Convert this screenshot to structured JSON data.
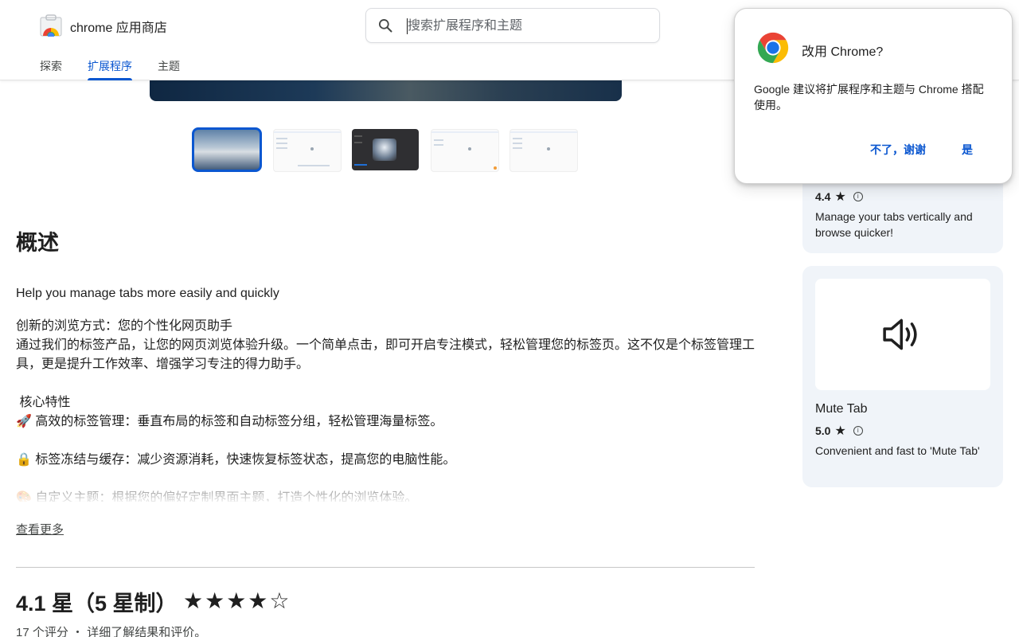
{
  "header": {
    "brand": "chrome 应用商店",
    "search_placeholder": "搜索扩展程序和主题",
    "tabs": [
      {
        "label": "探索",
        "active": false
      },
      {
        "label": "扩展程序",
        "active": true
      },
      {
        "label": "主题",
        "active": false
      }
    ],
    "accent_color": "#0b57d0"
  },
  "overview": {
    "title": "概述",
    "summary": "Help you manage tabs more easily and quickly",
    "description": [
      "创新的浏览方式：您的个性化网页助手",
      "通过我们的标签产品，让您的网页浏览体验升级。一个简单点击，即可开启专注模式，轻松管理您的标签页。这不仅是个标签管理工具，更是提升工作效率、增强学习专注的得力助手。",
      "",
      " 核心特性",
      "🚀 高效的标签管理：垂直布局的标签和自动标签分组，轻松管理海量标签。",
      "",
      "🔒 标签冻结与缓存：减少资源消耗，快速恢复标签状态，提高您的电脑性能。",
      "",
      "🎨 自定义主题：根据您的偏好定制界面主题，打造个性化的浏览体验。"
    ],
    "see_more": "查看更多"
  },
  "ratings": {
    "heading": "4.1 星（5 星制）",
    "stars": "★★★★☆",
    "value": 4.1,
    "reviews_line": "17 个评分 ・ 详细了解结果和评价。"
  },
  "related": [
    {
      "rating": "4.4",
      "star": "★",
      "info": "i",
      "description": "Manage your tabs vertically and browse quicker!"
    },
    {
      "title": "Mute Tab",
      "icon": "speaker-icon",
      "rating": "5.0",
      "star": "★",
      "info": "i",
      "description": "Convenient and fast to 'Mute Tab'"
    }
  ],
  "popup": {
    "title": "改用 Chrome?",
    "body": "Google 建议将扩展程序和主题与 Chrome 搭配使用。",
    "decline": "不了，谢谢",
    "accept": "是"
  }
}
